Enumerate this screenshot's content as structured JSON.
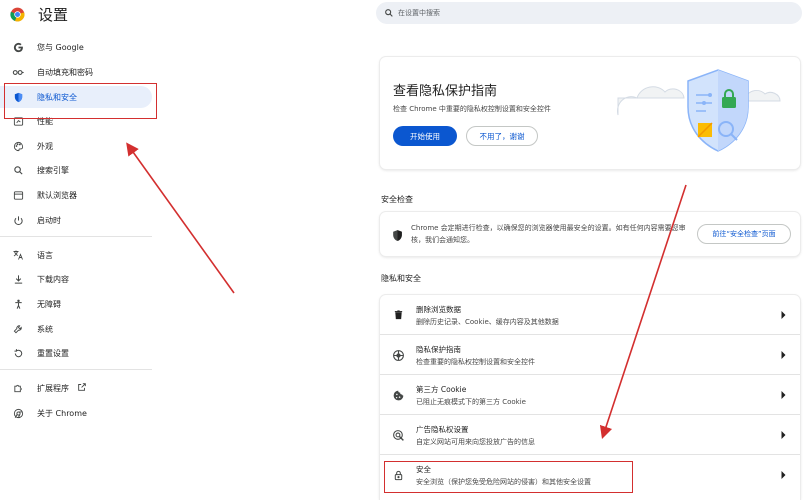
{
  "app": {
    "title": "设置"
  },
  "search": {
    "placeholder": "在设置中搜索"
  },
  "sidebar": {
    "items": [
      {
        "label": "您与 Google",
        "icon": "google-g-icon"
      },
      {
        "label": "自动填充和密码",
        "icon": "key-icon"
      },
      {
        "label": "隐私和安全",
        "icon": "shield-icon",
        "active": true
      },
      {
        "label": "性能",
        "icon": "speedometer-icon"
      },
      {
        "label": "外观",
        "icon": "palette-icon"
      },
      {
        "label": "搜索引擎",
        "icon": "search-icon"
      },
      {
        "label": "默认浏览器",
        "icon": "browser-window-icon"
      },
      {
        "label": "启动时",
        "icon": "power-icon"
      },
      {
        "label": "语言",
        "icon": "translate-icon"
      },
      {
        "label": "下载内容",
        "icon": "download-icon"
      },
      {
        "label": "无障碍",
        "icon": "accessibility-icon"
      },
      {
        "label": "系统",
        "icon": "wrench-icon"
      },
      {
        "label": "重置设置",
        "icon": "reset-icon"
      },
      {
        "label": "扩展程序",
        "icon": "puzzle-icon"
      },
      {
        "label": "关于 Chrome",
        "icon": "chrome-icon"
      }
    ]
  },
  "guide_card": {
    "title": "查看隐私保护指南",
    "description": "检查 Chrome 中重要的隐私权控制设置和安全控件",
    "primary_button": "开始使用",
    "secondary_button": "不用了，谢谢"
  },
  "safety_check": {
    "header": "安全检查",
    "text": "Chrome 会定期进行检查，以确保您的浏览器使用最安全的设置。如有任何内容需要您审核，我们会通知您。",
    "button": "前往“安全检查”页面"
  },
  "privacy": {
    "header": "隐私和安全",
    "items": [
      {
        "title": "删除浏览数据",
        "subtitle": "删除历史记录、Cookie、缓存内容及其他数据",
        "icon": "trash-icon"
      },
      {
        "title": "隐私保护指南",
        "subtitle": "检查重要的隐私权控制设置和安全控件",
        "icon": "privacy-guide-icon"
      },
      {
        "title": "第三方 Cookie",
        "subtitle": "已阻止无痕模式下的第三方 Cookie",
        "icon": "cookie-icon"
      },
      {
        "title": "广告隐私权设置",
        "subtitle": "自定义网站可用来向您投放广告的信息",
        "icon": "ad-privacy-icon"
      },
      {
        "title": "安全",
        "subtitle": "安全浏览（保护您免受危险网站的侵害）和其他安全设置",
        "icon": "lock-icon"
      }
    ]
  },
  "colors": {
    "accent": "#0b57d0",
    "active_bg": "#e8effb",
    "annotation": "#d32f2f"
  }
}
